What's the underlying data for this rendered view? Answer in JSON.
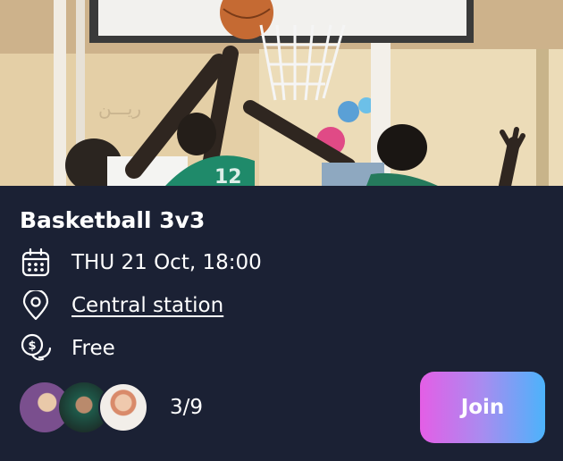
{
  "event": {
    "image_alt": "basketball-players-image",
    "title": "Basketball 3v3",
    "date": "THU 21 Oct, 18:00",
    "location": "Central station",
    "price": "Free",
    "participants": "3/9",
    "join_label": "Join"
  },
  "icons": {
    "date": "calendar-icon",
    "location": "map-pin-icon",
    "price": "coin-icon"
  },
  "colors": {
    "card_bg": "#1b2134",
    "text": "#ffffff",
    "join_gradient_start": "#e45ee6",
    "join_gradient_end": "#4cb3fb"
  }
}
